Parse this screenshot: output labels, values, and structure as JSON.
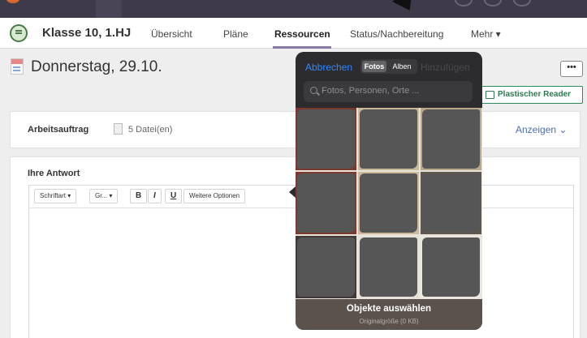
{
  "navbar": {
    "class_title": "Klasse 10, 1.HJ",
    "links": [
      "Übersicht",
      "Pläne",
      "Ressourcen",
      "Status/Nachbereitung",
      "Mehr ▾"
    ]
  },
  "page": {
    "title": "Donnerstag, 29.10.",
    "more_label": "•••",
    "reader_label": "Plastischer Reader"
  },
  "assignment": {
    "label": "Arbeitsauftrag",
    "files": "5 Datei(en)",
    "show": "Anzeigen ⌄"
  },
  "answer": {
    "label": "Ihre Antwort",
    "toolbar": {
      "font": "Schriftart ▾",
      "size": "Gr... ▾",
      "bold": "B",
      "italic": "I",
      "underline": "U",
      "more": "Weitere Optionen"
    }
  },
  "photo_picker": {
    "cancel": "Abbrechen",
    "tab_photos": "Fotos",
    "tab_albums": "Alben",
    "add": "Hinzufügen",
    "search_placeholder": "Fotos, Personen, Orte ...",
    "footer_title": "Objekte auswählen",
    "footer_sub": "Originalgröße (0 KB)"
  },
  "colors": {
    "accent_green": "#2f7a52",
    "link_blue": "#4a6fb5",
    "ios_blue": "#2f86ff",
    "nav_underline": "#8b7aa8"
  }
}
